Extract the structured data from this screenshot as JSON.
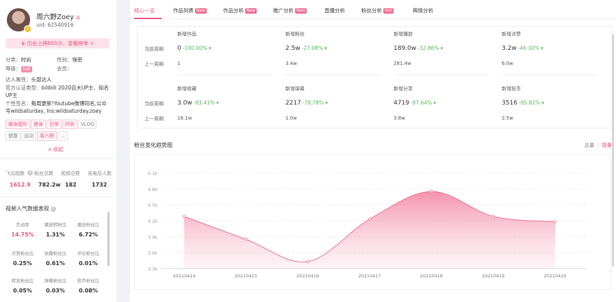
{
  "profile": {
    "name": "周六野Zoey",
    "uid": "uid: 62540916",
    "rank_text": "历史上榜865次，查看榜单 >",
    "category_label": "分类：",
    "category": "时尚",
    "gender_label": "性别：",
    "gender": "保密",
    "level_label": "等级：",
    "level": "lv6",
    "member_label": "会员：",
    "member": "",
    "attr_label": "达人属性：",
    "attr": "头部达人",
    "cert_label": "官方认证类型：",
    "cert": "bilibili 2020百大UP主、知名UP主",
    "sign_label": "个性签名：",
    "sign": "每周更新!Youtube微博同名,公众号wildsaturday, Ins:wildsaturday.zoey",
    "tags": [
      "瘦身塑形",
      "健身",
      "日常",
      "时尚",
      "VLOG",
      "健康",
      "运动",
      "周六野",
      "..."
    ],
    "collapse": "∧ 收起"
  },
  "stats": [
    {
      "label": "飞瓜指数",
      "value": "1612.9",
      "pink": true
    },
    {
      "label": "粉丝总数",
      "value": "782.2w"
    },
    {
      "label": "视频总数",
      "value": "182"
    },
    {
      "label": "充电总人数",
      "value": "1732"
    }
  ],
  "popularity": {
    "title": "视频人气数据表现",
    "rows": [
      [
        {
          "label": "互动率",
          "value": "14.75%",
          "pink": true
        },
        {
          "label": "播放转粉比",
          "value": "1.31%"
        },
        {
          "label": "播放粉丝比",
          "value": "6.72%"
        }
      ],
      [
        {
          "label": "点赞粉丝比",
          "value": "0.25%"
        },
        {
          "label": "收藏粉丝比",
          "value": "0.61%"
        },
        {
          "label": "评论粉丝比",
          "value": "0.01%"
        }
      ],
      [
        {
          "label": "转发粉丝比",
          "value": "0.05%"
        },
        {
          "label": "弹幕粉丝比",
          "value": "0.03%"
        },
        {
          "label": "投币粉丝比",
          "value": "0.08%"
        }
      ]
    ]
  },
  "tabs": [
    {
      "label": "核心一览",
      "badge": ""
    },
    {
      "label": "作品列表",
      "badge": "New"
    },
    {
      "label": "作品分析",
      "badge": "New"
    },
    {
      "label": "推广分析",
      "badge": "New"
    },
    {
      "label": "直播分析",
      "badge": ""
    },
    {
      "label": "粉丝分析",
      "badge": "Hot"
    },
    {
      "label": "舆情分析",
      "badge": ""
    }
  ],
  "metrics": {
    "current_label": "当前周期",
    "prev_label": "上一周期",
    "rows": [
      [
        {
          "title": "新增作品",
          "value": "0",
          "change": "-100.00%",
          "prev": "1"
        },
        {
          "title": "新增粉丝",
          "value": "2.5w",
          "change": "-27.08%",
          "prev": "3.4w"
        },
        {
          "title": "新增播放",
          "value": "189.0w",
          "change": "-32.86%",
          "prev": "281.4w"
        },
        {
          "title": "新增点赞",
          "value": "3.2w",
          "change": "-46.30%",
          "prev": "6.0w"
        }
      ],
      [
        {
          "title": "新增收藏",
          "value": "3.0w",
          "change": "-83.41%",
          "prev": "18.1w"
        },
        {
          "title": "新增弹幕",
          "value": "2217",
          "change": "-78.78%",
          "prev": "1.0w"
        },
        {
          "title": "新增分享",
          "value": "4719",
          "change": "-87.64%",
          "prev": "3.8w"
        },
        {
          "title": "新增投币",
          "value": "3516",
          "change": "-85.82%",
          "prev": "2.5w"
        }
      ]
    ]
  },
  "chart_title": "粉丝变化趋势图",
  "chart_toggle": {
    "total": "总量",
    "increment": "增量"
  },
  "chart_data": {
    "type": "area",
    "x": [
      "20210414",
      "20210415",
      "20210416",
      "20210417",
      "20210418",
      "20210419",
      "20210420"
    ],
    "series": [
      {
        "values": [
          4280,
          3850,
          3430,
          4230,
          4750,
          4280,
          4180
        ]
      }
    ],
    "yticks": [
      "5.1k",
      "4.8k",
      "4.5k",
      "4.2k",
      "3.9k",
      "3.6k",
      "3.3k"
    ],
    "ylim": [
      3300,
      5100
    ],
    "color": "#f06e92",
    "grid": true
  },
  "colors": {
    "accent": "#e9557c",
    "up": "#5cb85c"
  }
}
